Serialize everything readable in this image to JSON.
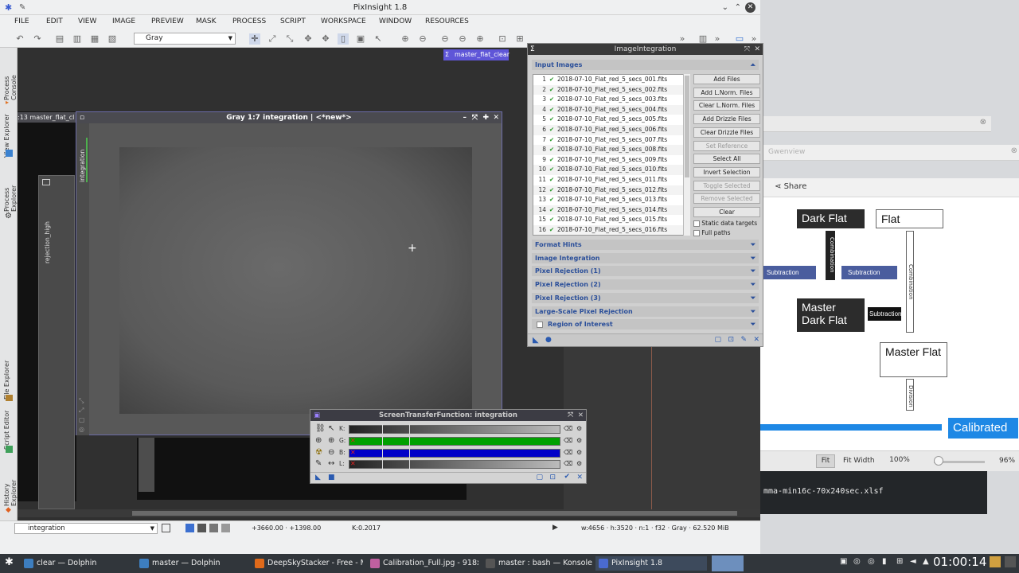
{
  "app": {
    "title": "PixInsight 1.8"
  },
  "menu": [
    "FILE",
    "EDIT",
    "VIEW",
    "IMAGE",
    "PREVIEW",
    "MASK",
    "PROCESS",
    "SCRIPT",
    "WORKSPACE",
    "WINDOW",
    "RESOURCES"
  ],
  "toolbar": {
    "color_mode": "Gray"
  },
  "side_tabs": [
    "Process Console",
    "View Explorer",
    "Process Explorer",
    "File Explorer",
    "Script Editor",
    "History Explorer"
  ],
  "workspace": {
    "badge": "master_flat_clear",
    "bg_window_title": ":13 master_flat_cl",
    "high_tab": "rejection_high",
    "integration_tab": "integration"
  },
  "image_window": {
    "title": "Gray 1:7 integration | <*new*>"
  },
  "image_integration": {
    "title": "ImageIntegration",
    "input_images_label": "Input Images",
    "files": [
      "2018-07-10_Flat_red_5_secs_001.fits",
      "2018-07-10_Flat_red_5_secs_002.fits",
      "2018-07-10_Flat_red_5_secs_003.fits",
      "2018-07-10_Flat_red_5_secs_004.fits",
      "2018-07-10_Flat_red_5_secs_005.fits",
      "2018-07-10_Flat_red_5_secs_006.fits",
      "2018-07-10_Flat_red_5_secs_007.fits",
      "2018-07-10_Flat_red_5_secs_008.fits",
      "2018-07-10_Flat_red_5_secs_009.fits",
      "2018-07-10_Flat_red_5_secs_010.fits",
      "2018-07-10_Flat_red_5_secs_011.fits",
      "2018-07-10_Flat_red_5_secs_012.fits",
      "2018-07-10_Flat_red_5_secs_013.fits",
      "2018-07-10_Flat_red_5_secs_014.fits",
      "2018-07-10_Flat_red_5_secs_015.fits",
      "2018-07-10_Flat_red_5_secs_016.fits"
    ],
    "buttons": [
      {
        "label": "Add Files",
        "enabled": true
      },
      {
        "label": "Add L.Norm. Files",
        "enabled": true
      },
      {
        "label": "Clear L.Norm. Files",
        "enabled": true
      },
      {
        "label": "Add Drizzle Files",
        "enabled": true
      },
      {
        "label": "Clear Drizzle Files",
        "enabled": true
      },
      {
        "label": "Set Reference",
        "enabled": false
      },
      {
        "label": "Select All",
        "enabled": true
      },
      {
        "label": "Invert Selection",
        "enabled": true
      },
      {
        "label": "Toggle Selected",
        "enabled": false
      },
      {
        "label": "Remove Selected",
        "enabled": false
      },
      {
        "label": "Clear",
        "enabled": true
      }
    ],
    "checkboxes": [
      {
        "label": "Static data targets",
        "checked": false
      },
      {
        "label": "Full paths",
        "checked": false
      }
    ],
    "sections": [
      "Format Hints",
      "Image Integration",
      "Pixel Rejection (1)",
      "Pixel Rejection (2)",
      "Pixel Rejection (3)",
      "Large-Scale Pixel Rejection",
      "Region of Interest"
    ]
  },
  "stf": {
    "title": "ScreenTransferFunction: integration",
    "channels": [
      {
        "label": "K:",
        "color": "#5a5a5a"
      },
      {
        "label": "G:",
        "color": "#00a000"
      },
      {
        "label": "B:",
        "color": "#0000c8"
      },
      {
        "label": "L:",
        "color": "#6a6a6a"
      }
    ]
  },
  "statusbar": {
    "view": "integration",
    "coords": "+3660.00 · +1398.00",
    "k_value": "K:0.2017",
    "info": "w:4656 · h:3520 · n:1 · f32 · Gray · 62.520 MiB"
  },
  "gwenview": {
    "title": "Gwenview",
    "share": "Share",
    "nodes": {
      "dark_flat": "Dark Flat",
      "flat": "Flat",
      "master_dark_flat": "Master Dark Flat",
      "master_flat": "Master Flat",
      "calibrated": "Calibrated"
    },
    "arrows": [
      "Subtraction",
      "Subtraction",
      "Subtraction",
      "Combination",
      "Combination",
      "Division"
    ],
    "zoom": {
      "fit": "Fit",
      "fit_width": "Fit Width",
      "level": "100%",
      "percent": "96%"
    }
  },
  "konsole": {
    "text": "mma-min16c-70x240sec.xlsf"
  },
  "taskbar": {
    "tasks": [
      {
        "label": "clear — Dolphin",
        "color": "#3d7ebf"
      },
      {
        "label": "master — Dolphin",
        "color": "#3d7ebf"
      },
      {
        "label": "DeepSkyStacker - Free - Mo...",
        "color": "#e06a1a"
      },
      {
        "label": "Calibration_Full.jpg - 918x4...",
        "color": "#c060a0"
      },
      {
        "label": "master : bash — Konsole",
        "color": "#555"
      },
      {
        "label": "PixInsight 1.8",
        "color": "#4a6ad0"
      }
    ],
    "clock": "01:00:14"
  }
}
